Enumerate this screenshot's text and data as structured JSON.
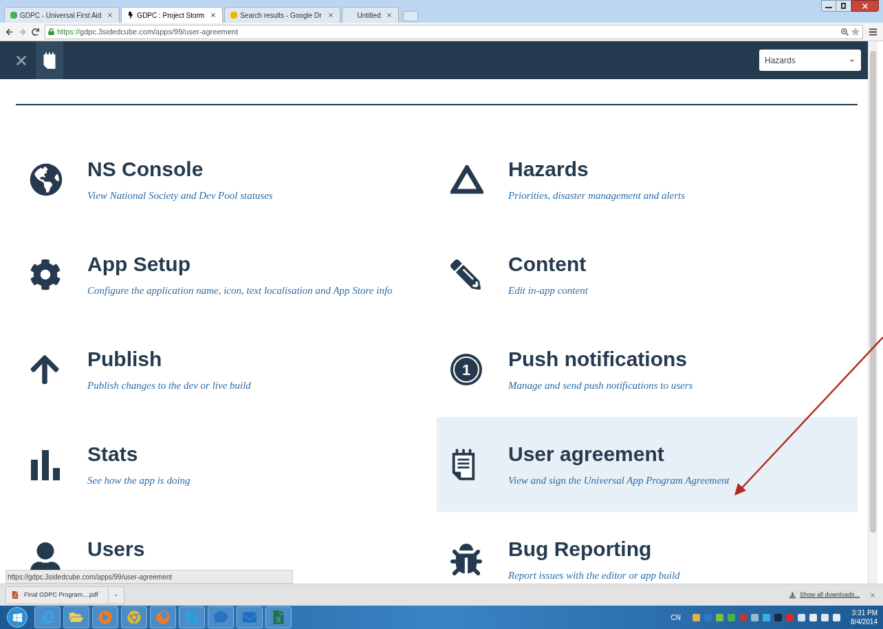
{
  "browser": {
    "tabs": [
      {
        "title": "GDPC - Universal First Aid",
        "selected": false
      },
      {
        "title": "GDPC : Project Storm",
        "selected": true
      },
      {
        "title": "Search results - Google Dr",
        "selected": false
      },
      {
        "title": "Untitled",
        "selected": false
      }
    ],
    "url_scheme": "https://",
    "url_rest": "gdpc.3sidedcube.com/apps/99/user-agreement"
  },
  "app_header": {
    "dropdown": "Hazards"
  },
  "menu": {
    "items": [
      {
        "title": "NS Console",
        "description": "View National Society and Dev Pool statuses",
        "selected": false
      },
      {
        "title": "Hazards",
        "description": "Priorities, disaster management and alerts",
        "selected": false
      },
      {
        "title": "App Setup",
        "description": "Configure the application name, icon, text localisation and App Store info",
        "selected": false
      },
      {
        "title": "Content",
        "description": "Edit in-app content",
        "selected": false
      },
      {
        "title": "Publish",
        "description": "Publish changes to the dev or live build",
        "selected": false
      },
      {
        "title": "Push notifications",
        "description": "Manage and send push notifications to users",
        "selected": false,
        "badge": "1"
      },
      {
        "title": "Stats",
        "description": "See how the app is doing",
        "selected": false
      },
      {
        "title": "User agreement",
        "description": "View and sign the Universal App Program Agreement",
        "selected": true
      },
      {
        "title": "Users",
        "selected": false
      },
      {
        "title": "Bug Reporting",
        "description": "Report issues with the editor or app build",
        "selected": false
      }
    ]
  },
  "status_url": "https://gdpc.3sidedcube.com/apps/99/user-agreement",
  "downloads": {
    "file": "Final GDPC Program....pdf",
    "show_all": "Show all downloads..."
  },
  "taskbar": {
    "language": "CN",
    "time": "3:31 PM",
    "date": "8/4/2014"
  }
}
